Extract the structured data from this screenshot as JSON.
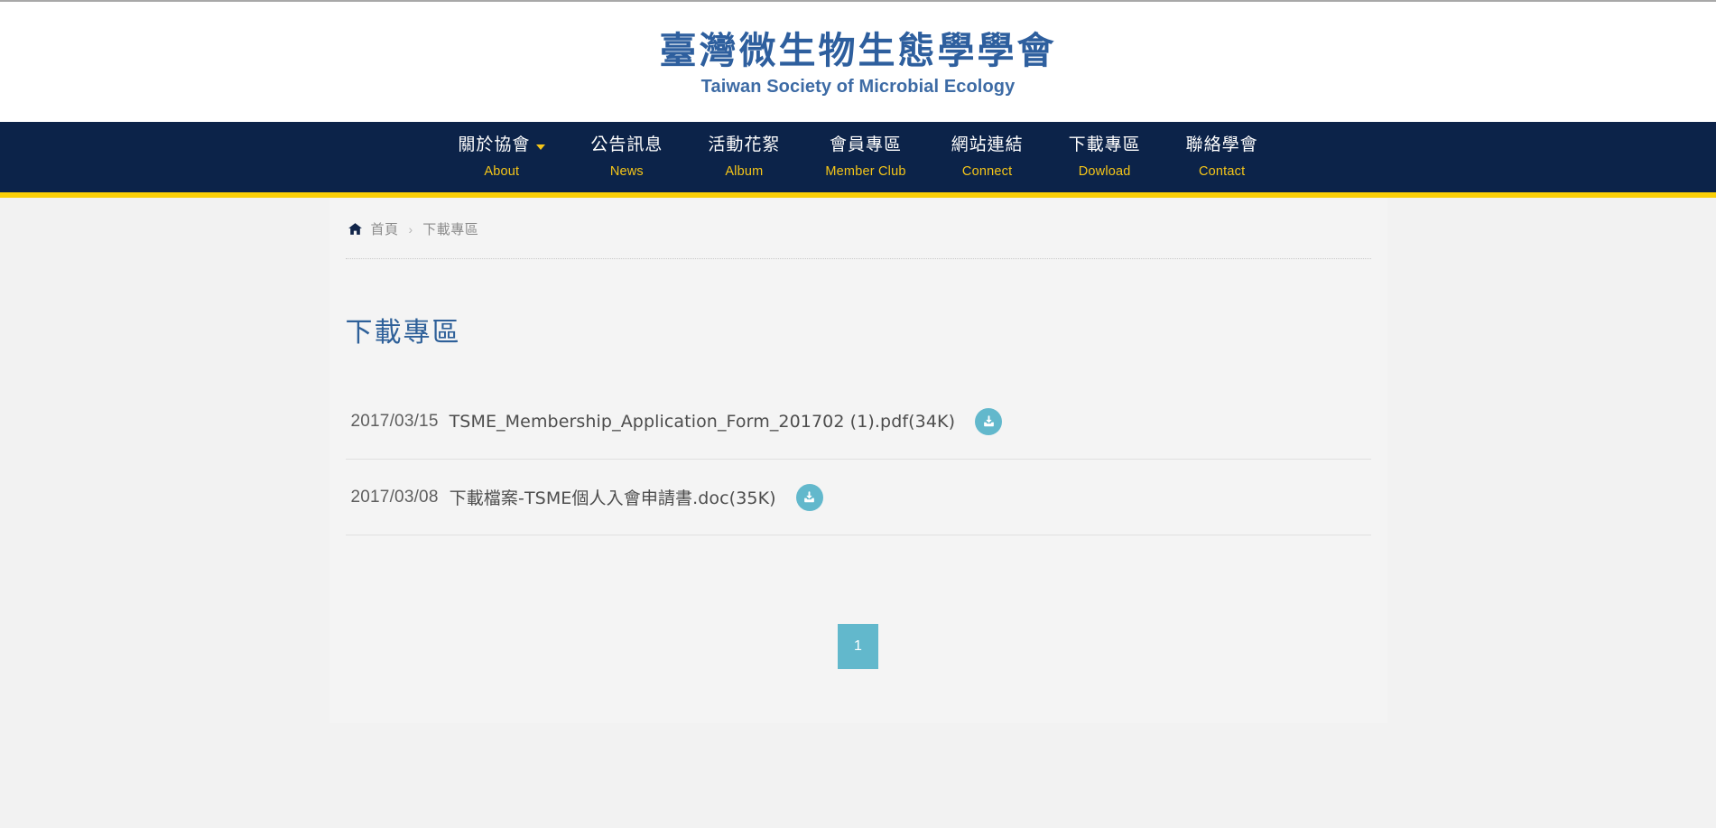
{
  "header": {
    "logo_cn": "臺灣微生物生態學學會",
    "logo_en": "Taiwan Society of Microbial Ecology"
  },
  "colors": {
    "nav_bg": "#0c2349",
    "nav_stripe": "#fbcf07",
    "accent_gold": "#f5c518",
    "logo_blue": "#2e5f9e",
    "title_blue": "#2e6099",
    "teal": "#62b8cc",
    "page_bg": "#f2f2f2",
    "panel_bg": "#f4f4f4"
  },
  "nav": {
    "items": [
      {
        "cn": "關於協會",
        "en": "About",
        "has_dropdown": true,
        "icon": "chevron-down-icon"
      },
      {
        "cn": "公告訊息",
        "en": "News",
        "has_dropdown": false
      },
      {
        "cn": "活動花絮",
        "en": "Album",
        "has_dropdown": false
      },
      {
        "cn": "會員專區",
        "en": "Member Club",
        "has_dropdown": false
      },
      {
        "cn": "網站連結",
        "en": "Connect",
        "has_dropdown": false
      },
      {
        "cn": "下載專區",
        "en": "Dowload",
        "has_dropdown": false
      },
      {
        "cn": "聯絡學會",
        "en": "Contact",
        "has_dropdown": false
      }
    ]
  },
  "breadcrumb": {
    "home_icon": "home-icon",
    "home_label": "首頁",
    "separator": "›",
    "current": "下載專區"
  },
  "main": {
    "title": "下載專區",
    "downloads": [
      {
        "date": "2017/03/15",
        "filename": "TSME_Membership_Application_Form_201702 (1).pdf(34K)",
        "download_icon": "download-icon"
      },
      {
        "date": "2017/03/08",
        "filename": "下載檔案-TSME個人入會申請書.doc(35K)",
        "download_icon": "download-icon"
      }
    ]
  },
  "pagination": {
    "pages": [
      {
        "label": "1",
        "active": true
      }
    ]
  }
}
